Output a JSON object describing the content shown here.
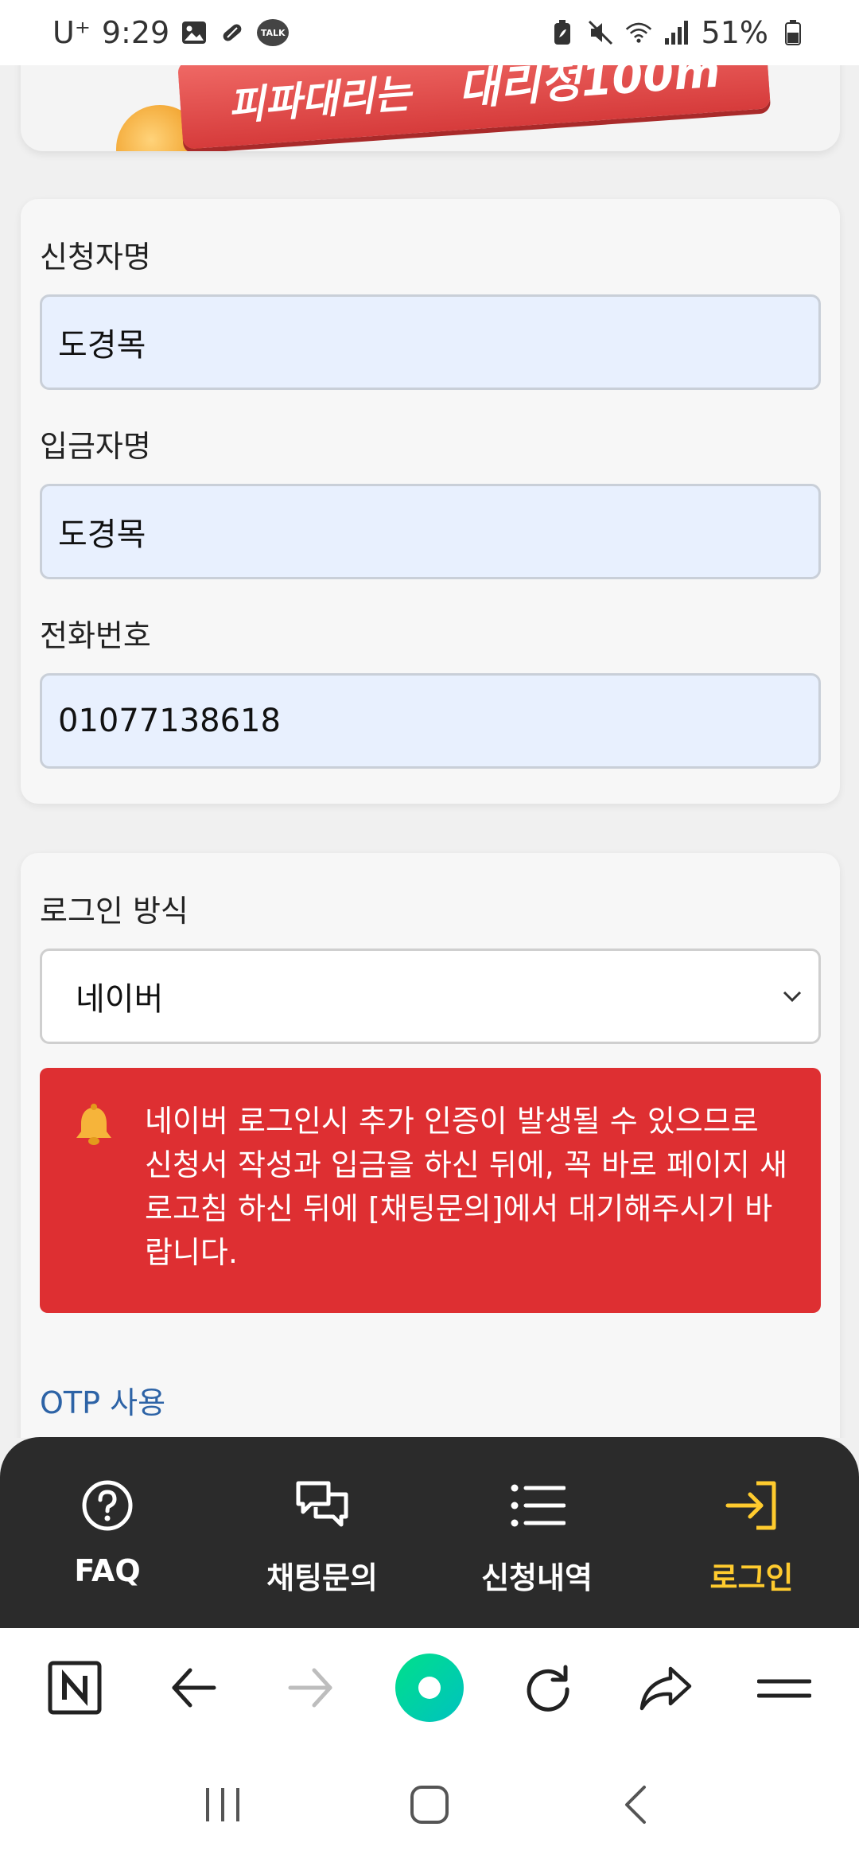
{
  "status_bar": {
    "carrier": "U⁺",
    "time": "9:29",
    "talk_badge": "TALK",
    "battery": "51%"
  },
  "banner": {
    "text_left": "피파대리는",
    "text_right": "대리정100m"
  },
  "applicant": {
    "name_label": "신청자명",
    "name_value": "도경목",
    "depositor_label": "입금자명",
    "depositor_value": "도경목",
    "phone_label": "전화번호",
    "phone_value": "01077138618"
  },
  "login": {
    "method_label": "로그인 방식",
    "method_value": "네이버",
    "alert_text": "네이버 로그인시 추가 인증이 발생될 수 있으므로 신청서 작성과 입금을 하신 뒤에, 꼭 바로 페이지 새로고침 하신 뒤에 [채팅문의]에서 대기해주시기 바랍니다.",
    "otp_label": "OTP 사용"
  },
  "tabs": [
    {
      "label": "FAQ",
      "icon": "question-circle-icon"
    },
    {
      "label": "채팅문의",
      "icon": "chat-bubbles-icon"
    },
    {
      "label": "신청내역",
      "icon": "list-icon"
    },
    {
      "label": "로그인",
      "icon": "login-arrow-icon",
      "active": true
    }
  ],
  "colors": {
    "alert_red": "#de2f32",
    "tab_bar_bg": "#2b2b2b",
    "active_tab": "#ffcb2e",
    "input_bg": "#e8f0fe",
    "otp_link": "#2d63a6",
    "browser_accent": "#00d47a"
  }
}
